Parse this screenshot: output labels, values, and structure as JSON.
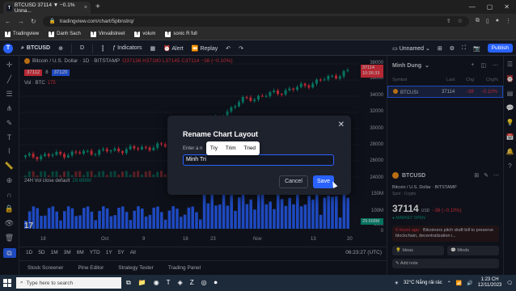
{
  "browser": {
    "tab_title": "BTCUSD 37114 ▼ −0.1% Unna...",
    "url": "tradingview.com/chart/5pbnstrq/",
    "bookmarks": [
      {
        "label": "Tradingview",
        "icon": "tv-icon"
      },
      {
        "label": "Danh Sach",
        "icon": "tv-icon"
      },
      {
        "label": "Vinvallstreet",
        "icon": "tv-icon"
      },
      {
        "label": "volum",
        "icon": "tv-icon"
      },
      {
        "label": "sonic R full",
        "icon": "tv-icon"
      }
    ]
  },
  "toolbar": {
    "symbol": "BTCUSD",
    "interval": "D",
    "indicators": "Indicators",
    "alert": "Alert",
    "replay": "Replay",
    "layout_name": "Unnamed",
    "publish": "Publish"
  },
  "chart": {
    "legend_title": "Bitcoin / U.S. Dollar · 1D · BITSTAMP",
    "legend_ohlc": "O37136 H37180 L37145 C37114 −38 (−0.10%)",
    "sell_price": "37112",
    "spread": "8",
    "buy_price": "37120",
    "vol_label": "Vol · BTC",
    "vol_value": "175",
    "lower_label": "24H Vol close default",
    "lower_value": "29.668M",
    "current_price_tag": "37114",
    "current_price_time": "10:36:33",
    "vol_tag": "175",
    "vol_tag2": "29.668M",
    "y_labels": [
      "38000",
      "36000",
      "34000",
      "32000",
      "30000",
      "28000",
      "26000",
      "24000",
      "150M",
      "100M",
      "50M",
      "0"
    ],
    "x_labels": [
      "18",
      "Oct",
      "9",
      "16",
      "23",
      "Nov",
      "13",
      "20"
    ],
    "timeframes": [
      "1D",
      "5D",
      "1M",
      "3M",
      "6M",
      "YTD",
      "1Y",
      "5Y",
      "All"
    ],
    "clock": "06:23:27 (UTC)",
    "panels": [
      "Stock Screener",
      "Pine Editor",
      "Strategy Tester",
      "Trading Panel"
    ]
  },
  "chart_data": {
    "type": "bar",
    "title": "Bitcoin / U.S. Dollar · 1D · BITSTAMP",
    "ylim": [
      24000,
      38500
    ],
    "categories": [
      "18",
      "Oct",
      "9",
      "16",
      "23",
      "Nov",
      "13"
    ],
    "values": [
      26500,
      27000,
      27500,
      28200,
      33500,
      35000,
      37114
    ]
  },
  "watchlist": {
    "owner": "Minh Dung",
    "columns": [
      "Symbol",
      "Last",
      "Chg",
      "Chg%"
    ],
    "rows": [
      {
        "symbol": "BTCUSI",
        "last": "37114",
        "chg": "−38",
        "chgp": "−0.10%"
      }
    ]
  },
  "detail": {
    "symbol": "BTCUSD",
    "name": "Bitcoin / U.S. Dollar  · BITSTAMP",
    "type": "Spot · Crypto",
    "price": "37114",
    "currency": "USD",
    "change": "−38 (−0.10%)",
    "market": "● MARKET OPEN",
    "news_time": "6 hours ago · ",
    "news_text": "Bitcoiners pitch draft bill to preserve blockchain, decentralization i...",
    "ideas": "Ideas",
    "minds": "Minds",
    "add_note": "Add note"
  },
  "dialog": {
    "title": "Rename Chart Layout",
    "label": "Enter a n",
    "value": "Minh Tri",
    "cancel": "Cancel",
    "save": "Save",
    "suggestions": [
      "Try",
      "Trim",
      "Tried"
    ]
  },
  "taskbar": {
    "search_placeholder": "Type here to search",
    "weather": "32°C  Nắng rải rác",
    "time": "1:23 CH",
    "date": "12/11/2023"
  }
}
